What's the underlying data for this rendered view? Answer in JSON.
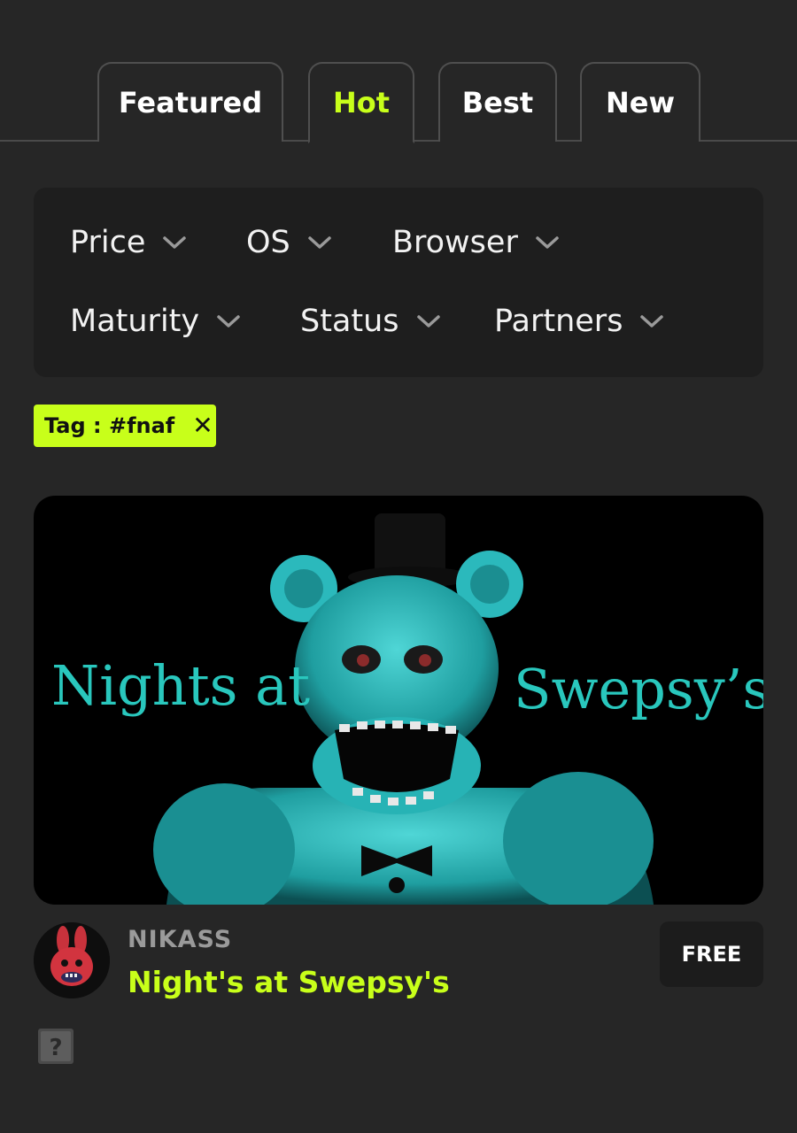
{
  "tabs": [
    {
      "label": "Featured",
      "active": false
    },
    {
      "label": "Hot",
      "active": true
    },
    {
      "label": "Best",
      "active": false
    },
    {
      "label": "New",
      "active": false
    }
  ],
  "filters": {
    "price": "Price",
    "os": "OS",
    "browser": "Browser",
    "maturity": "Maturity",
    "status": "Status",
    "partners": "Partners",
    "chevron_icon": "chevron-down-icon"
  },
  "active_tag": {
    "label": "Tag : #fnaf",
    "remove_icon": "close-icon",
    "remove_glyph": "✕"
  },
  "game": {
    "cover_text_left": "Nights at",
    "cover_text_right": "Swepsy’s",
    "author": "NIKASS",
    "title": "Night's at Swepsy's",
    "price": "FREE",
    "platform_icon": "unknown-platform-icon"
  },
  "colors": {
    "background": "#262626",
    "panel": "#1e1e1e",
    "accent": "#c8ff1a",
    "cover_text": "#29c7bd"
  }
}
